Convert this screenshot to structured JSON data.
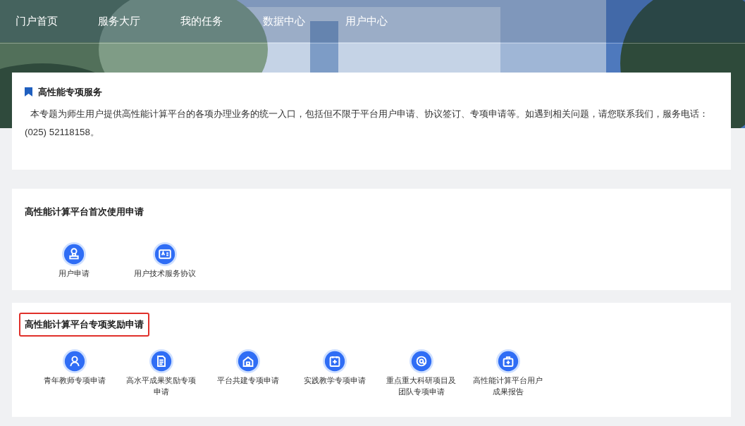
{
  "nav": [
    {
      "label": "门户首页"
    },
    {
      "label": "服务大厅"
    },
    {
      "label": "我的任务"
    },
    {
      "label": "数据中心"
    },
    {
      "label": "用户中心"
    }
  ],
  "intro": {
    "title": "高性能专项服务",
    "text": "本专题为师生用户提供高性能计算平台的各项办理业务的统一入口，包括但不限于平台用户申请、协议签订、专项申请等。如遇到相关问题，请您联系我们，服务电话：(025) 52118158。"
  },
  "sections": [
    {
      "title": "高性能计算平台首次使用申请",
      "highlighted": false,
      "items": [
        {
          "label": "用户申请",
          "kind": "stamp"
        },
        {
          "label": "用户技术服务协议",
          "kind": "card"
        }
      ]
    },
    {
      "title": "高性能计算平台专项奖励申请",
      "highlighted": true,
      "items": [
        {
          "label": "青年教师专项申请",
          "kind": "user"
        },
        {
          "label": "高水平成果奖励专项申请",
          "kind": "doc"
        },
        {
          "label": "平台共建专项申请",
          "kind": "home"
        },
        {
          "label": "实践教学专项申请",
          "kind": "plus"
        },
        {
          "label": "重点重大科研项目及团队专项申请",
          "kind": "target"
        },
        {
          "label": "高性能计算平台用户成果报告",
          "kind": "bag"
        }
      ]
    }
  ]
}
